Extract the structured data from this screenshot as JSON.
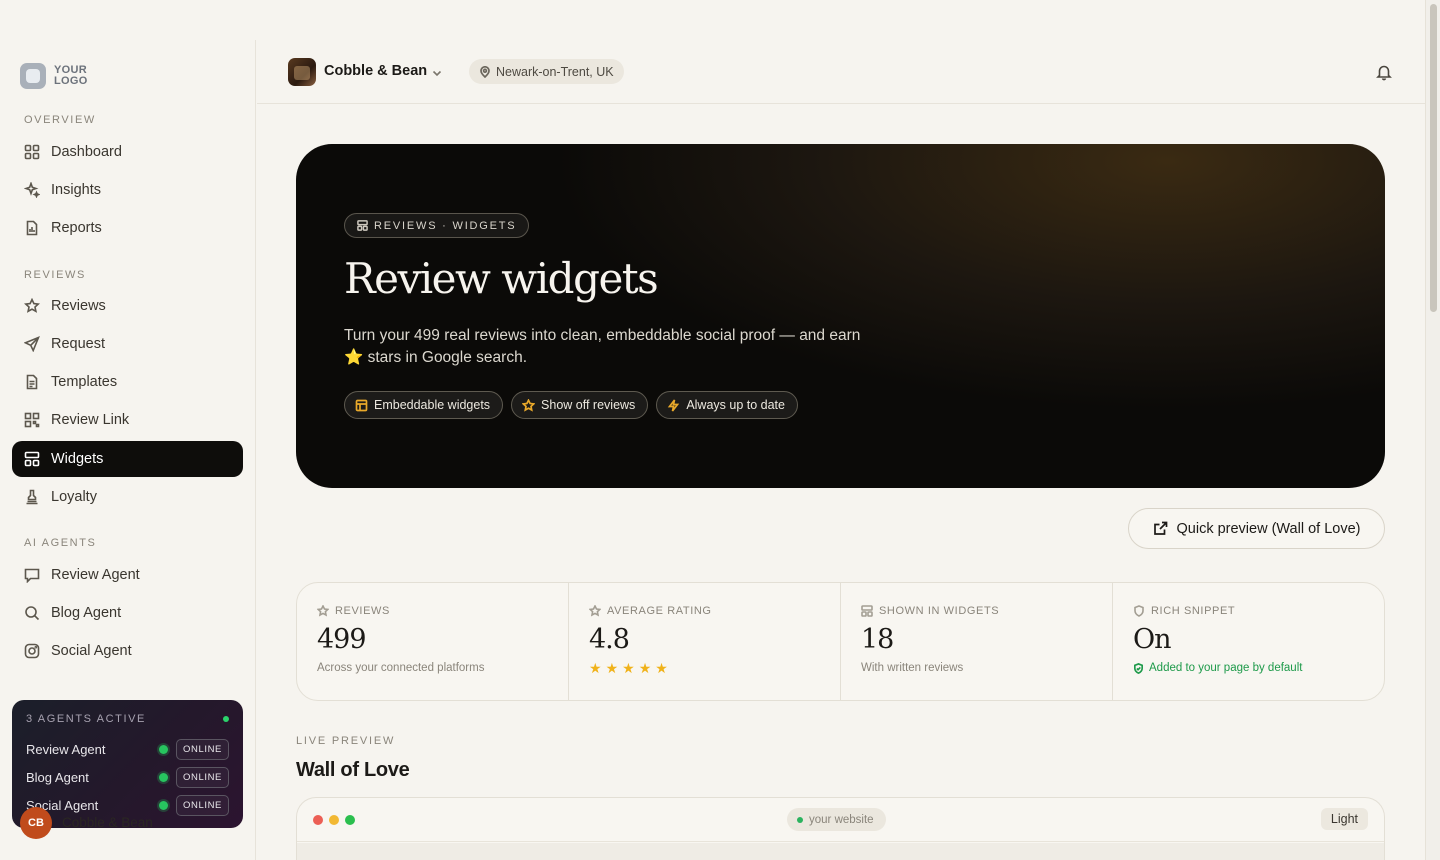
{
  "brand": {
    "logo_text": "YOUR LOGO"
  },
  "sidebar": {
    "sections": [
      {
        "label": "OVERVIEW",
        "items": [
          {
            "label": "Dashboard",
            "icon": "grid-icon"
          },
          {
            "label": "Insights",
            "icon": "sparkles-icon"
          },
          {
            "label": "Reports",
            "icon": "report-icon"
          }
        ]
      },
      {
        "label": "REVIEWS",
        "items": [
          {
            "label": "Reviews",
            "icon": "star-icon"
          },
          {
            "label": "Request",
            "icon": "send-icon"
          },
          {
            "label": "Templates",
            "icon": "document-icon"
          },
          {
            "label": "Review Link",
            "icon": "qr-code-icon"
          },
          {
            "label": "Widgets",
            "icon": "widgets-icon",
            "active": true
          },
          {
            "label": "Loyalty",
            "icon": "stamp-icon"
          }
        ]
      },
      {
        "label": "AI AGENTS",
        "items": [
          {
            "label": "Review Agent",
            "icon": "message-icon"
          },
          {
            "label": "Blog Agent",
            "icon": "search-icon"
          },
          {
            "label": "Social Agent",
            "icon": "instagram-icon"
          }
        ]
      }
    ],
    "agents_card": {
      "title": "3 AGENTS ACTIVE",
      "agents": [
        {
          "name": "Review Agent",
          "status": "ONLINE"
        },
        {
          "name": "Blog Agent",
          "status": "ONLINE"
        },
        {
          "name": "Social Agent",
          "status": "ONLINE"
        }
      ]
    },
    "user": {
      "initials": "CB",
      "name": "Cobble & Bean"
    }
  },
  "topbar": {
    "business_name": "Cobble & Bean",
    "location": "Newark-on-Trent, UK"
  },
  "hero": {
    "badge": "REVIEWS · WIDGETS",
    "title": "Review widgets",
    "desc_before": "Turn your 499 real reviews into clean, embeddable social proof — and earn ",
    "desc_star": "⭐",
    "desc_after": " stars in Google search.",
    "chips": [
      "Embeddable widgets",
      "Show off reviews",
      "Always up to date"
    ]
  },
  "quick_preview": {
    "label": "Quick preview (Wall of Love)"
  },
  "stats": [
    {
      "label": "REVIEWS",
      "value": "499",
      "sub": "Across your connected platforms",
      "icon": "star-icon"
    },
    {
      "label": "AVERAGE RATING",
      "value": "4.8",
      "stars": 5,
      "icon": "star-icon"
    },
    {
      "label": "SHOWN IN WIDGETS",
      "value": "18",
      "sub": "With written reviews",
      "icon": "widgets-icon"
    },
    {
      "label": "RICH SNIPPET",
      "value": "On",
      "sub": "Added to your page by default",
      "icon": "shield-check-icon"
    }
  ],
  "live_preview": {
    "label": "LIVE PREVIEW",
    "title": "Wall of Love",
    "url": "your website",
    "theme_toggle": "Light"
  },
  "colors": {
    "accent_dark": "#0e0d0b",
    "star": "#f0b21a",
    "success": "#1e9a4a",
    "traffic_red": "#ec5f55",
    "traffic_yellow": "#f2b833",
    "traffic_green": "#2bbf4e"
  }
}
